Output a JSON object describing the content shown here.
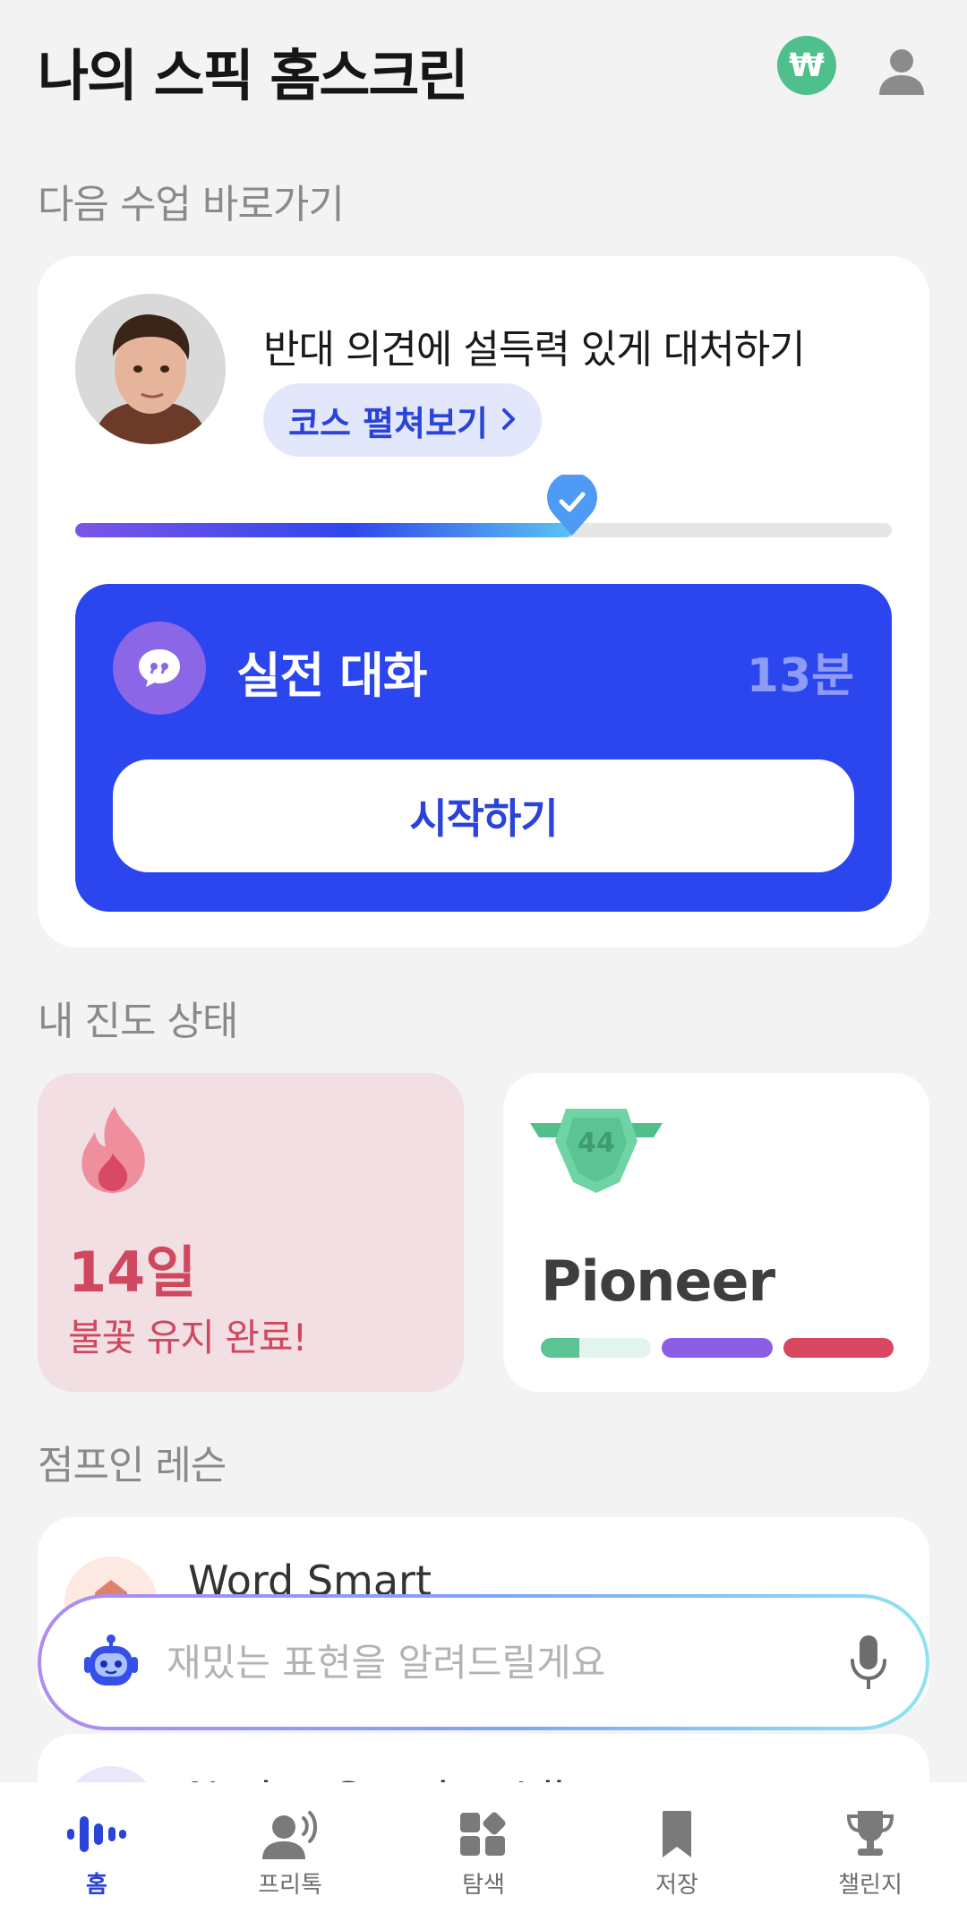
{
  "header": {
    "title": "나의 스픽 홈스크린",
    "won_symbol": "₩",
    "won_icon": "won-icon",
    "profile_icon": "profile-icon"
  },
  "next_lesson": {
    "section_title": "다음 수업 바로가기",
    "lesson_title": "반대 의견에 설득력 있게 대처하기",
    "course_button": "코스 펼쳐보기",
    "progress_fraction": 0.61,
    "session": {
      "label": "실전 대화",
      "duration": "13분",
      "start_button": "시작하기"
    }
  },
  "progress_status": {
    "section_title": "내 진도 상태",
    "streak": {
      "days": "14일",
      "message": "불꽃 유지 완료!"
    },
    "level": {
      "badge_number": "44",
      "name": "Pioneer"
    }
  },
  "jump_in": {
    "section_title": "점프인 레슨",
    "items": [
      {
        "title": "Word Smart"
      },
      {
        "title": "Native Speaker Idioms"
      }
    ]
  },
  "ai_bar": {
    "placeholder": "재밌는 표현을 알려드릴게요"
  },
  "bottom_nav": {
    "items": [
      {
        "label": "홈",
        "icon": "home-wave-icon",
        "active": true
      },
      {
        "label": "프리톡",
        "icon": "free-talk-icon",
        "active": false
      },
      {
        "label": "탐색",
        "icon": "explore-icon",
        "active": false
      },
      {
        "label": "저장",
        "icon": "bookmark-icon",
        "active": false
      },
      {
        "label": "챌린지",
        "icon": "trophy-icon",
        "active": false
      }
    ]
  },
  "colors": {
    "accent": "#2b45ef",
    "streak": "#d0485f",
    "won_badge": "#4fbf8c"
  }
}
